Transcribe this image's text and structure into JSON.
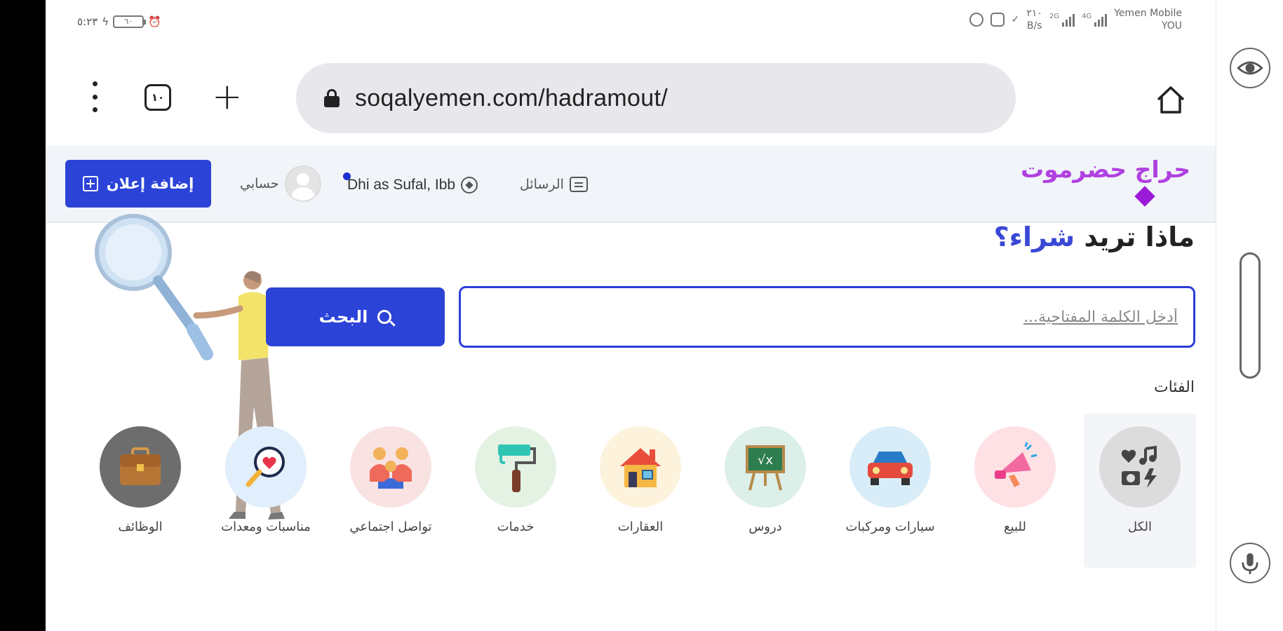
{
  "status_bar": {
    "time": "٥:٢٣",
    "battery": "٦٠",
    "carrier_name": "Yemen Mobile",
    "carrier_sub": "YOU",
    "speed_value": "٢١٠",
    "speed_unit": "B/s",
    "signal_1_label": "2G",
    "signal_2_label": "4G"
  },
  "browser": {
    "tab_count": "١٠",
    "url": "soqalyemen.com/hadramout/"
  },
  "header": {
    "logo": "حراج حضرموت",
    "messages_label": "الرسائل",
    "location_label": "Dhi as Sufal, Ibb",
    "account_label": "حسابي",
    "add_ad_label": "إضافة إعلان"
  },
  "main": {
    "question_prefix": "ماذا تريد",
    "question_accent": "شراء؟",
    "search_placeholder": "أدخل الكلمة المفتاحية...",
    "search_button": "البحث",
    "categories_heading": "الفئات"
  },
  "categories": [
    {
      "label": "الكل",
      "icon": "media-all-icon",
      "color": "#dcdcdc"
    },
    {
      "label": "للبيع",
      "icon": "megaphone-icon",
      "color": "#fde1e4"
    },
    {
      "label": "سيارات ومركبات",
      "icon": "car-icon",
      "color": "#d8edf8"
    },
    {
      "label": "دروس",
      "icon": "chalkboard-icon",
      "color": "#dcefe8"
    },
    {
      "label": "العقارات",
      "icon": "house-icon",
      "color": "#fdf2dc"
    },
    {
      "label": "خدمات",
      "icon": "paint-roller-icon",
      "color": "#e4f2e4"
    },
    {
      "label": "تواصل اجتماعي",
      "icon": "people-icon",
      "color": "#f9e2e2"
    },
    {
      "label": "مناسبات ومعدات",
      "icon": "heart-magnifier-icon",
      "color": "#e1eefb"
    },
    {
      "label": "الوظائف",
      "icon": "briefcase-icon",
      "color": "#6d6d6d"
    }
  ]
}
